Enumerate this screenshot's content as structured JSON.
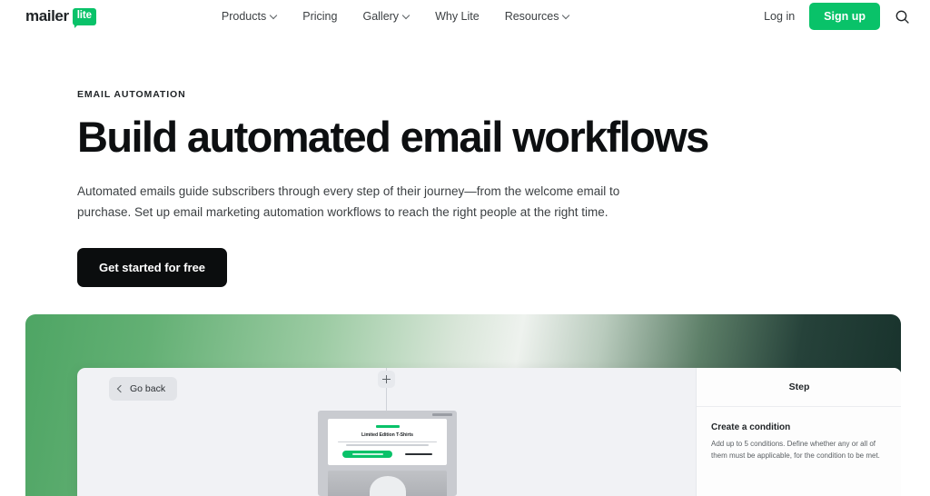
{
  "header": {
    "logo": {
      "word": "mailer",
      "badge": "lite"
    },
    "nav": [
      {
        "label": "Products",
        "has_dropdown": true
      },
      {
        "label": "Pricing",
        "has_dropdown": false
      },
      {
        "label": "Gallery",
        "has_dropdown": true
      },
      {
        "label": "Why Lite",
        "has_dropdown": false
      },
      {
        "label": "Resources",
        "has_dropdown": true
      }
    ],
    "login_label": "Log in",
    "signup_label": "Sign up",
    "search_icon": "search-icon"
  },
  "hero": {
    "eyebrow": "EMAIL AUTOMATION",
    "title": "Build automated email workflows",
    "subtitle": "Automated emails guide subscribers through every step of their journey—from the welcome email to purchase. Set up email marketing automation workflows to reach the right people at the right time.",
    "cta_label": "Get started for free"
  },
  "showcase": {
    "go_back_label": "Go back",
    "back_icon": "chevron-left-icon",
    "add_step_icon": "plus-icon",
    "email_preview": {
      "title": "Limited Edition T-Shirts"
    },
    "step_panel": {
      "header": "Step",
      "title": "Create a condition",
      "description": "Add up to 5 conditions. Define whether any or all of them must be applicable, for the condition to be met."
    }
  },
  "colors": {
    "brand_green": "#09c269",
    "cta_black": "#0b0d0e",
    "gradient_start": "#4ea564",
    "gradient_mid": "#eef2ee",
    "gradient_end": "#16302a"
  }
}
